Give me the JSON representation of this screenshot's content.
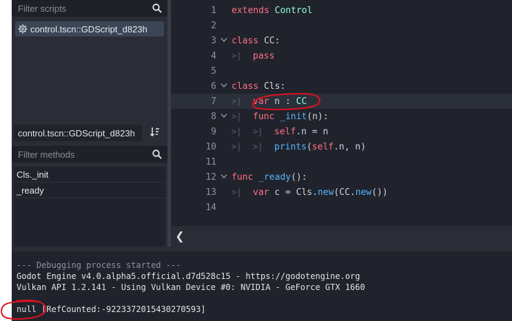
{
  "script_panel": {
    "filter_placeholder": "Filter scripts",
    "scripts": [
      {
        "label": "control.tscn::GDScript_d823h"
      }
    ]
  },
  "method_panel": {
    "script_name": "control.tscn::GDScript_d823h",
    "filter_placeholder": "Filter methods",
    "methods": [
      {
        "label": "Cls._init"
      },
      {
        "label": "_ready"
      }
    ]
  },
  "editor": {
    "lines": [
      {
        "n": "1",
        "fold": "",
        "indent": 0,
        "tokens": [
          [
            "kw",
            "extends"
          ],
          [
            "ident",
            " "
          ],
          [
            "type",
            "Control"
          ]
        ]
      },
      {
        "n": "2",
        "fold": "",
        "indent": 0,
        "tokens": []
      },
      {
        "n": "3",
        "fold": "v",
        "indent": 0,
        "tokens": [
          [
            "kw",
            "class"
          ],
          [
            "ident",
            " CC:"
          ]
        ]
      },
      {
        "n": "4",
        "fold": "",
        "indent": 1,
        "tokens": [
          [
            "kw",
            "pass"
          ]
        ]
      },
      {
        "n": "5",
        "fold": "",
        "indent": 0,
        "tokens": []
      },
      {
        "n": "6",
        "fold": "v",
        "indent": 0,
        "tokens": [
          [
            "kw",
            "class"
          ],
          [
            "ident",
            " Cls:"
          ]
        ]
      },
      {
        "n": "7",
        "fold": "",
        "indent": 1,
        "active": true,
        "tokens": [
          [
            "kw",
            "var"
          ],
          [
            "ident",
            " n : "
          ],
          [
            "type",
            "CC"
          ]
        ]
      },
      {
        "n": "8",
        "fold": "v",
        "indent": 1,
        "tokens": [
          [
            "kw",
            "func"
          ],
          [
            "ident",
            " "
          ],
          [
            "fn",
            "_init"
          ],
          [
            "ident",
            "(n):"
          ]
        ]
      },
      {
        "n": "9",
        "fold": "",
        "indent": 2,
        "tokens": [
          [
            "kw",
            "self"
          ],
          [
            "ident",
            ".n = n"
          ]
        ]
      },
      {
        "n": "10",
        "fold": "",
        "indent": 2,
        "tokens": [
          [
            "fn",
            "prints"
          ],
          [
            "ident",
            "("
          ],
          [
            "kw",
            "self"
          ],
          [
            "ident",
            ".n, n)"
          ]
        ]
      },
      {
        "n": "11",
        "fold": "",
        "indent": 0,
        "tokens": []
      },
      {
        "n": "12",
        "fold": "v",
        "indent": 0,
        "tokens": [
          [
            "kw",
            "func"
          ],
          [
            "ident",
            " "
          ],
          [
            "fn",
            "_ready"
          ],
          [
            "ident",
            "():"
          ]
        ]
      },
      {
        "n": "13",
        "fold": "",
        "indent": 1,
        "tokens": [
          [
            "kw",
            "var"
          ],
          [
            "ident",
            " c = Cls."
          ],
          [
            "fn",
            "new"
          ],
          [
            "ident",
            "(CC."
          ],
          [
            "fn",
            "new"
          ],
          [
            "ident",
            "())"
          ]
        ]
      },
      {
        "n": "14",
        "fold": "",
        "indent": 0,
        "tokens": []
      }
    ],
    "collapse_glyph": "❮"
  },
  "output": {
    "lines": [
      {
        "text": "--- Debugging process started ---",
        "dim": true
      },
      {
        "text": "Godot Engine v4.0.alpha5.official.d7d528c15 - https://godotengine.org",
        "dim": false
      },
      {
        "text": "Vulkan API 1.2.141 - Using Vulkan Device #0: NVIDIA - GeForce GTX 1660",
        "dim": false
      },
      {
        "text": "",
        "dim": false
      },
      {
        "text": "null [RefCounted:-9223372015430270593]",
        "dim": false
      }
    ]
  },
  "colors": {
    "keyword": "#ff7085",
    "type": "#8effda",
    "function": "#57b3ff",
    "annotation": "#e0121d"
  },
  "icons": {
    "search": "magnifier-icon",
    "script_item": "gear-icon",
    "sort": "sort-icon",
    "fold": "chevron-down-icon",
    "tab": "tab-marker-icon"
  }
}
